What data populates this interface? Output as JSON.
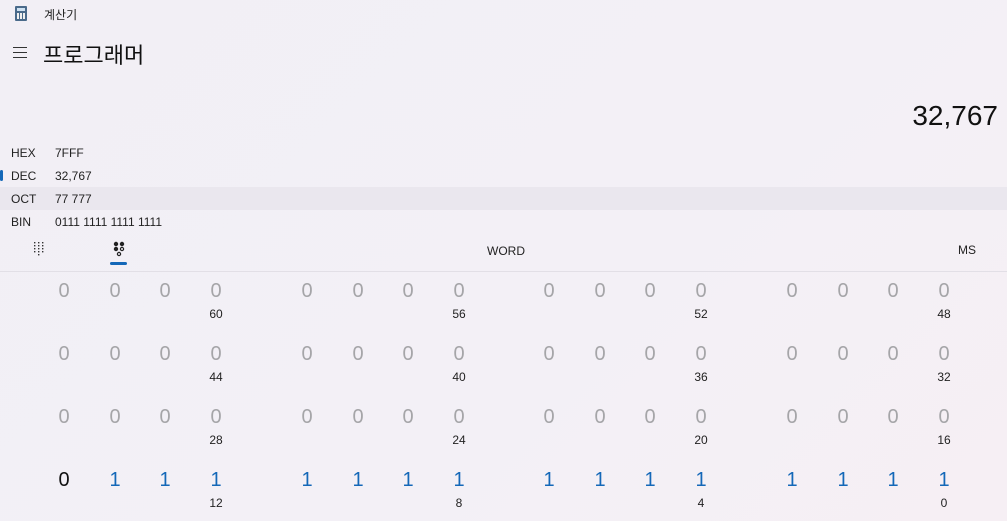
{
  "app": {
    "title": "계산기"
  },
  "header": {
    "mode": "프로그래머"
  },
  "display": {
    "value": "32,767"
  },
  "radix": [
    {
      "label": "HEX",
      "value": "7FFF"
    },
    {
      "label": "DEC",
      "value": "32,767"
    },
    {
      "label": "OCT",
      "value": "77 777"
    },
    {
      "label": "BIN",
      "value": "0111 1111 1111 1111"
    }
  ],
  "toolbar": {
    "word": "WORD",
    "ms": "MS"
  },
  "bits": {
    "rows": [
      [
        "0",
        "0",
        "0",
        "0",
        "0",
        "0",
        "0",
        "0",
        "0",
        "0",
        "0",
        "0",
        "0",
        "0",
        "0",
        "0"
      ],
      [
        "0",
        "0",
        "0",
        "0",
        "0",
        "0",
        "0",
        "0",
        "0",
        "0",
        "0",
        "0",
        "0",
        "0",
        "0",
        "0"
      ],
      [
        "0",
        "0",
        "0",
        "0",
        "0",
        "0",
        "0",
        "0",
        "0",
        "0",
        "0",
        "0",
        "0",
        "0",
        "0",
        "0"
      ],
      [
        "0",
        "1",
        "1",
        "1",
        "1",
        "1",
        "1",
        "1",
        "1",
        "1",
        "1",
        "1",
        "1",
        "1",
        "1",
        "1"
      ]
    ],
    "positions": [
      [
        "60",
        "56",
        "52",
        "48"
      ],
      [
        "44",
        "40",
        "36",
        "32"
      ],
      [
        "28",
        "24",
        "20",
        "16"
      ],
      [
        "12",
        "8",
        "4",
        "0"
      ]
    ]
  }
}
